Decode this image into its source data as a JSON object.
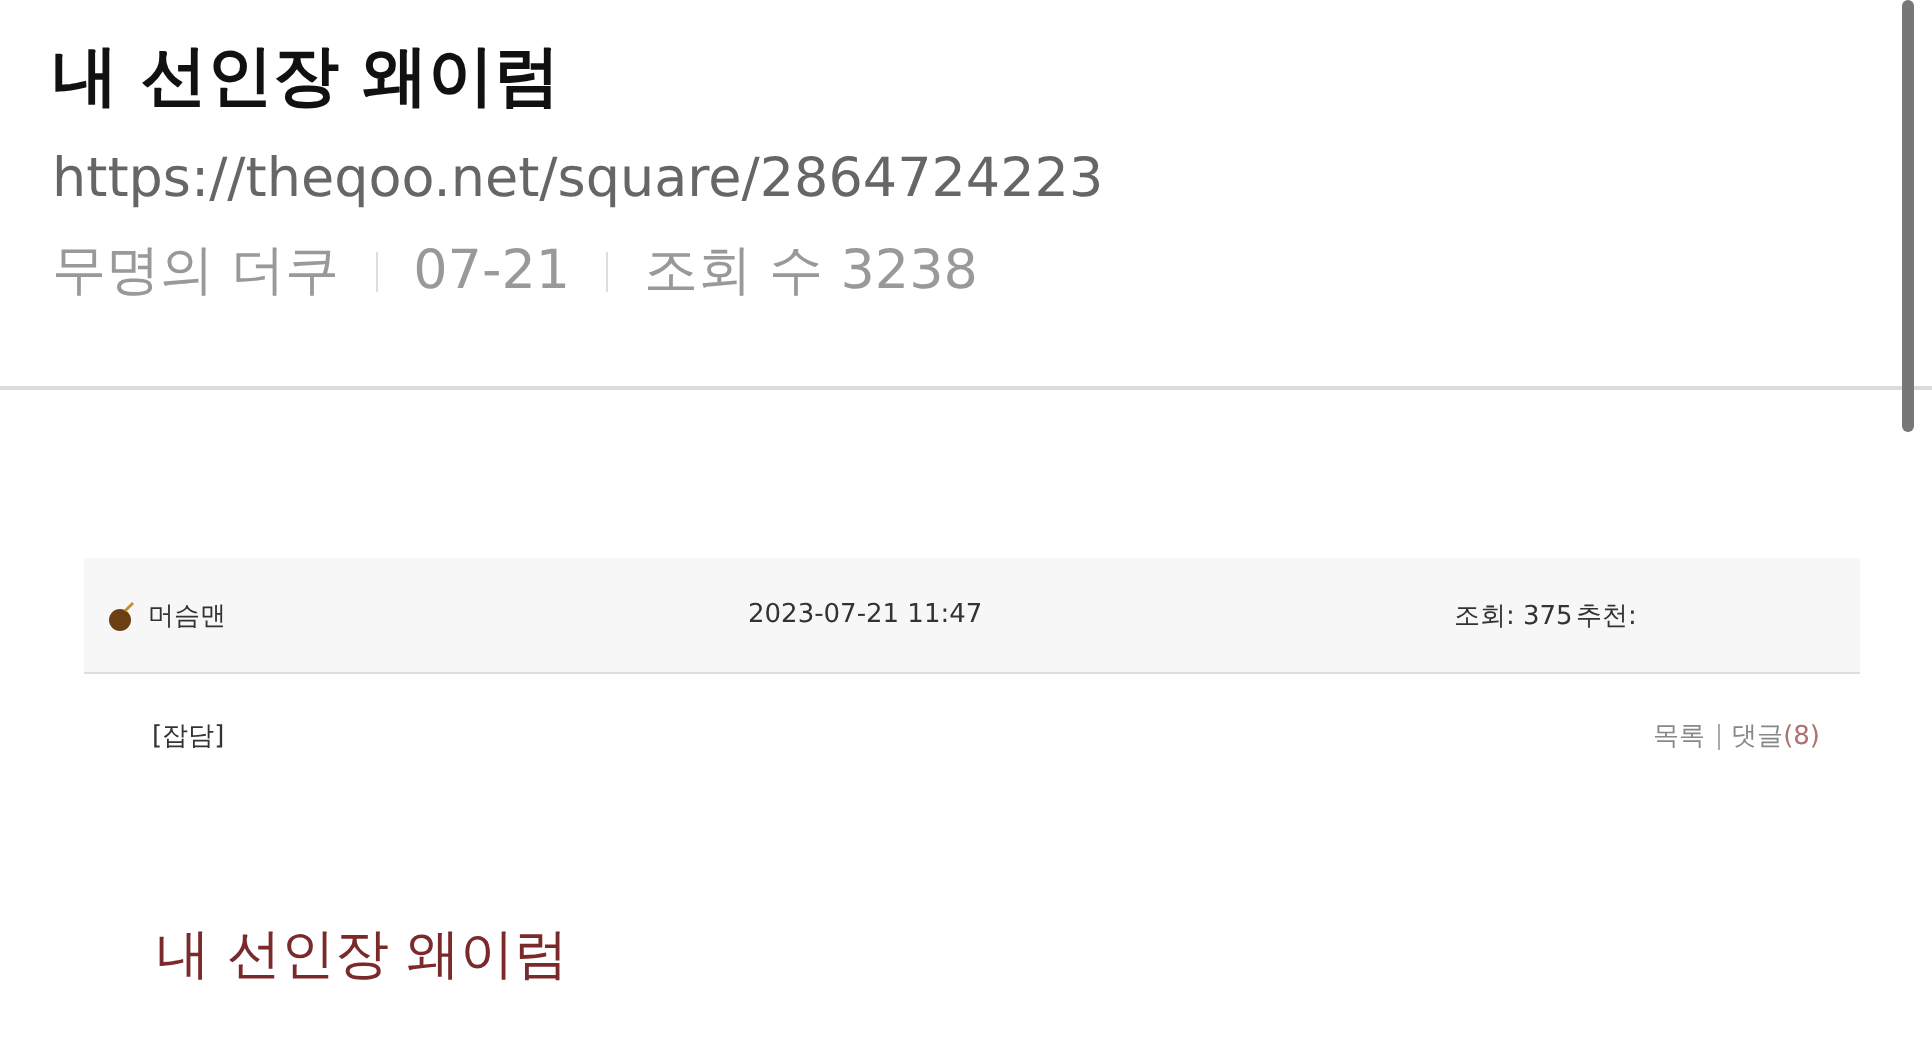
{
  "post": {
    "title": "내 선인장 왜이럼",
    "url": "https://theqoo.net/square/2864724223",
    "meta": [
      "무명의 더쿠",
      "07-21",
      "조회 수 3238"
    ]
  },
  "embedded": {
    "author": "머슴맨",
    "datetime": "2023-07-21 11:47",
    "views": "조회: 375",
    "recommend": "추천:",
    "category": "[잡담]",
    "links": [
      {
        "label": "목록"
      },
      {
        "label": "댓글",
        "count": "(8)"
      }
    ],
    "title": "내 선인장 왜이럼"
  }
}
